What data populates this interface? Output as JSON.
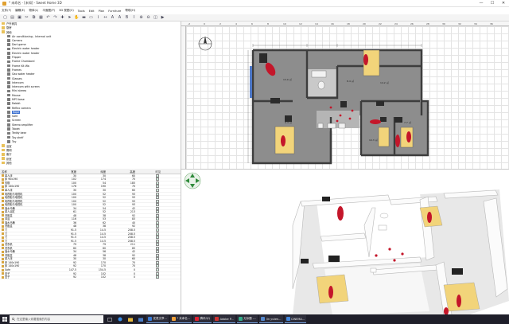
{
  "window": {
    "title": "* 未命名 - [未知] - Sweet Home 3D",
    "controls": [
      "—",
      "☐",
      "✕"
    ]
  },
  "menu": [
    "文件(F)",
    "编辑(E)",
    "物体(L)",
    "平面图(P)",
    "3D 视图(V)",
    "Tools",
    "Edit",
    "Plan",
    "Furniture",
    "帮助(H)"
  ],
  "toolbar_icons": [
    "new-file-icon",
    "open-icon",
    "save-icon",
    "cut-icon",
    "copy-icon",
    "paste-icon",
    "undo-icon",
    "redo-icon",
    "add-furniture-icon",
    "select-icon",
    "pan-icon",
    "wall-icon",
    "room-icon",
    "polyline-icon",
    "dimension-icon",
    "label-icon",
    "text-style-icon",
    "bold-icon",
    "italic-icon",
    "zoom-in-icon",
    "zoom-out-icon",
    "photo-icon",
    "video-icon"
  ],
  "catalog": {
    "items": [
      {
        "label": "户外家具",
        "indent": 0,
        "type": "folder"
      },
      {
        "label": "厨房",
        "indent": 0,
        "type": "folder"
      },
      {
        "label": "其他",
        "indent": 0,
        "type": "folder"
      },
      {
        "label": "Air conditioning - Internal unit",
        "indent": 1,
        "type": "item"
      },
      {
        "label": "Camera",
        "indent": 1,
        "type": "item"
      },
      {
        "label": "Dart game",
        "indent": 1,
        "type": "item"
      },
      {
        "label": "Electric water heater",
        "indent": 1,
        "type": "item"
      },
      {
        "label": "Electric water heater",
        "indent": 1,
        "type": "item"
      },
      {
        "label": "Flipper",
        "indent": 1,
        "type": "item"
      },
      {
        "label": "Frame Chambord",
        "indent": 1,
        "type": "item"
      },
      {
        "label": "Frame Kit Wa",
        "indent": 1,
        "type": "item"
      },
      {
        "label": "Frames",
        "indent": 1,
        "type": "item"
      },
      {
        "label": "Gas water heater",
        "indent": 1,
        "type": "item"
      },
      {
        "label": "Glasses",
        "indent": 1,
        "type": "item"
      },
      {
        "label": "Intercom",
        "indent": 1,
        "type": "item"
      },
      {
        "label": "Intercom with screen",
        "indent": 1,
        "type": "item"
      },
      {
        "label": "Mini stereo",
        "indent": 1,
        "type": "item"
      },
      {
        "label": "Mouse",
        "indent": 1,
        "type": "item"
      },
      {
        "label": "MP3 base",
        "indent": 1,
        "type": "item"
      },
      {
        "label": "Rabbit",
        "indent": 1,
        "type": "item"
      },
      {
        "label": "Reflex camera",
        "indent": 1,
        "type": "item"
      },
      {
        "label": "Rope",
        "indent": 1,
        "type": "item",
        "selected": true
      },
      {
        "label": "Safe",
        "indent": 1,
        "type": "item"
      },
      {
        "label": "Screen",
        "indent": 1,
        "type": "item"
      },
      {
        "label": "Stereo amplifier",
        "indent": 1,
        "type": "item"
      },
      {
        "label": "Tablet",
        "indent": 1,
        "type": "item"
      },
      {
        "label": "Teddy bear",
        "indent": 1,
        "type": "item"
      },
      {
        "label": "Toy shelf",
        "indent": 1,
        "type": "item"
      },
      {
        "label": "Toy",
        "indent": 1,
        "type": "item"
      },
      {
        "label": "浴室",
        "indent": 0,
        "type": "folder"
      },
      {
        "label": "照明",
        "indent": 0,
        "type": "folder"
      },
      {
        "label": "客厅",
        "indent": 0,
        "type": "folder"
      },
      {
        "label": "卧室",
        "indent": 0,
        "type": "folder"
      },
      {
        "label": "其他",
        "indent": 0,
        "type": "folder"
      }
    ]
  },
  "furniture_table": {
    "headers": [
      "名称",
      "宽度",
      "深度",
      "高度",
      "可见"
    ],
    "rows": [
      {
        "name": "单人床",
        "w": "30",
        "d": "30",
        "h": "60"
      },
      {
        "name": "床 90x190",
        "w": "102",
        "d": "174",
        "h": "70"
      },
      {
        "name": "衣橱",
        "w": "100",
        "d": "54",
        "h": "185"
      },
      {
        "name": "床 140x190",
        "w": "176",
        "d": "190",
        "h": "70"
      },
      {
        "name": "单人床",
        "w": "30",
        "d": "30",
        "h": "60"
      },
      {
        "name": "电视柜与电视机",
        "w": "100",
        "d": "52",
        "h": "93"
      },
      {
        "name": "电视柜与电视机",
        "w": "100",
        "d": "52",
        "h": "93"
      },
      {
        "name": "电视柜与电视机",
        "w": "100",
        "d": "52",
        "h": "93"
      },
      {
        "name": "电视柜与电视机",
        "w": "100",
        "d": "52",
        "h": "93"
      },
      {
        "name": "抽水马桶",
        "w": "34",
        "d": "54",
        "h": "42"
      },
      {
        "name": "单人浴缸",
        "w": "61",
        "d": "52",
        "h": "213"
      },
      {
        "name": "洗脸盆",
        "w": "48",
        "d": "38",
        "h": "92"
      },
      {
        "name": "沐浴",
        "w": "116",
        "d": "53",
        "h": "83"
      },
      {
        "name": "抽水马桶",
        "w": "36",
        "d": "62",
        "h": "40"
      },
      {
        "name": "洗脸盆",
        "w": "48",
        "d": "38",
        "h": "92"
      },
      {
        "name": "门",
        "w": "91.5",
        "d": "14.5",
        "h": "208.5"
      },
      {
        "name": "门",
        "w": "91.5",
        "d": "14.5",
        "h": "208.5"
      },
      {
        "name": "门",
        "w": "91.5",
        "d": "14.5",
        "h": "208.5"
      },
      {
        "name": "门",
        "w": "91.5",
        "d": "14.5",
        "h": "208.5"
      },
      {
        "name": "洗衣机",
        "w": "79",
        "d": "79",
        "h": "211"
      },
      {
        "name": "洗衣机",
        "w": "60",
        "d": "60",
        "h": "85"
      },
      {
        "name": "抽水马桶",
        "w": "34",
        "d": "56",
        "h": "42"
      },
      {
        "name": "洗脸盆",
        "w": "48",
        "d": "38",
        "h": "92"
      },
      {
        "name": "单人床",
        "w": "30",
        "d": "30",
        "h": "60"
      },
      {
        "name": "床 140x190",
        "w": "92",
        "d": "170",
        "h": "70"
      },
      {
        "name": "床 140x190",
        "w": "92",
        "d": "170",
        "h": "70"
      },
      {
        "name": "Safe",
        "w": "147.5",
        "d": "154.5",
        "h": "0"
      },
      {
        "name": "盒子",
        "w": "92",
        "d": "102",
        "h": "0"
      },
      {
        "name": "盒子",
        "w": "92",
        "d": "102",
        "h": "0"
      }
    ]
  },
  "plan_view": {
    "ruler_top": [
      "-2",
      "0",
      "2",
      "4",
      "6",
      "8",
      "10",
      "12",
      "14",
      "16",
      "18",
      "20",
      "22",
      "24",
      "26",
      "28",
      "30",
      "32",
      "34",
      "36"
    ],
    "room_labels": [
      "13.0 ㎡",
      "9.4 ㎡",
      "8.4 ㎡",
      "14.2 ㎡",
      "10.3 ㎡",
      "7.7 ㎡"
    ]
  },
  "taskbar": {
    "search_placeholder": "在这里输入你要搜索的内容",
    "tasks": [
      {
        "label": "发表文章...",
        "color": "#3a7bd5"
      },
      {
        "label": "* 未命名...",
        "color": "#f2a23a"
      },
      {
        "label": "腾讯QQ",
        "color": "#d23"
      },
      {
        "label": "Adobe P...",
        "color": "#c33"
      },
      {
        "label": "无标题 -...",
        "color": "#3a8"
      },
      {
        "label": "lin yuten...",
        "color": "#58c"
      },
      {
        "label": "CINEMA...",
        "color": "#48d"
      }
    ]
  },
  "colors": {
    "selection": "#3a6fd0",
    "wall": "#555555",
    "floor": "#8d8d8d",
    "bed": "#f2d47a",
    "rug": "#c4162a",
    "taskbar": "#1f1f2a"
  }
}
